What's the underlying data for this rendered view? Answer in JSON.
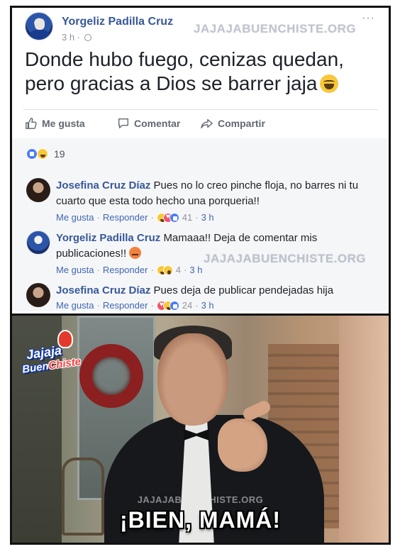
{
  "post": {
    "author": "Yorgeliz Padilla Cruz",
    "time": "3 h ·",
    "more": "···",
    "watermark": "JAJAJABUENCHISTE.ORG",
    "text": "Donde hubo fuego, cenizas quedan, pero gracias a Dios se barrer jaja",
    "actions": {
      "like": "Me gusta",
      "comment": "Comentar",
      "share": "Compartir"
    },
    "reaction_count": "19"
  },
  "comments": [
    {
      "name": "Josefina Cruz Díaz",
      "text": "Pues no lo creo pinche floja, no barres ni tu cuarto que esta todo hecho una porqueria!!",
      "like": "Me gusta",
      "reply": "Responder",
      "reactions": "41",
      "time": "3 h"
    },
    {
      "name": "Yorgeliz Padilla Cruz",
      "text": "Mamaaa!! Deja de comentar mis publicaciones!!",
      "like": "Me gusta",
      "reply": "Responder",
      "reactions": "4",
      "time": "3 h"
    },
    {
      "name": "Josefina Cruz Díaz",
      "text": "Pues deja de publicar pendejadas hija",
      "like": "Me gusta",
      "reply": "Responder",
      "reactions": "24",
      "time": "3 h"
    }
  ],
  "meme": {
    "logo_line1": "Jajaja",
    "logo_buen": "Buen",
    "logo_chiste": "Chiste",
    "watermark": "JAJAJABUENCHISTE.ORG",
    "caption": "¡BIEN, MAMÁ!"
  },
  "colors": {
    "link": "#365899",
    "muted": "#90949c",
    "text": "#1d2129"
  }
}
